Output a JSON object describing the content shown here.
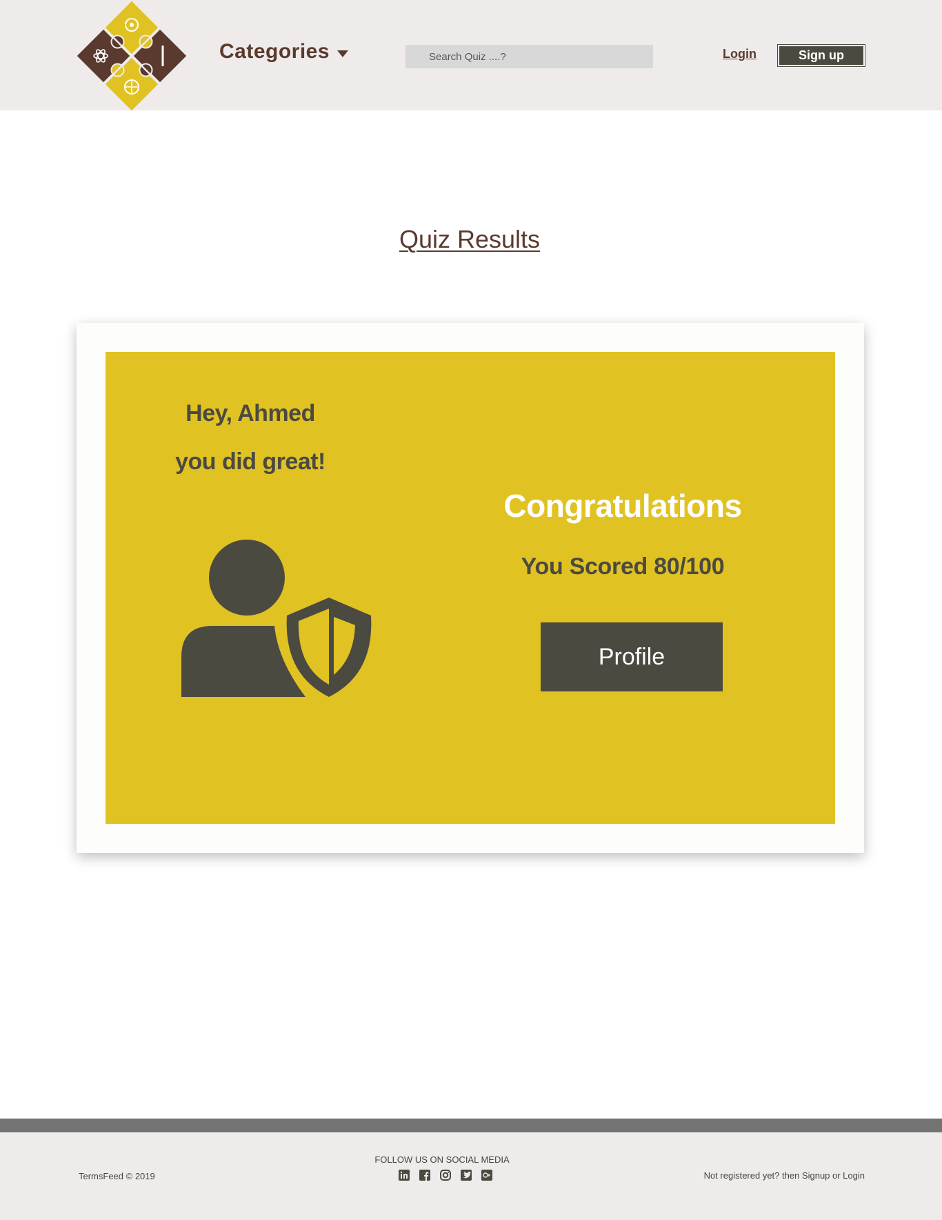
{
  "header": {
    "logo_name": "quiz-puzzle-logo",
    "categories_label": "Categories",
    "search_placeholder": "Search Quiz ....?",
    "login_label": "Login",
    "signup_label": "Sign up"
  },
  "main": {
    "title": "Quiz Results",
    "greeting_line1": "Hey, Ahmed",
    "greeting_line2": "you did great!",
    "congrats": "Congratulations",
    "score_text": "You Scored 80/100",
    "profile_button": "Profile"
  },
  "footer": {
    "copyright": "TermsFeed © 2019",
    "follow_label": "FOLLOW US ON SOCIAL MEDIA",
    "social_icons": [
      "linkedin-icon",
      "facebook-icon",
      "instagram-icon",
      "twitter-icon",
      "google-plus-icon"
    ],
    "signup_hint": "Not registered yet? then Signup or Login"
  },
  "colors": {
    "brand_brown": "#5a3a2e",
    "brand_yellow": "#e1c223",
    "dark_olive": "#4b4a40",
    "header_bg": "#eeebea"
  }
}
